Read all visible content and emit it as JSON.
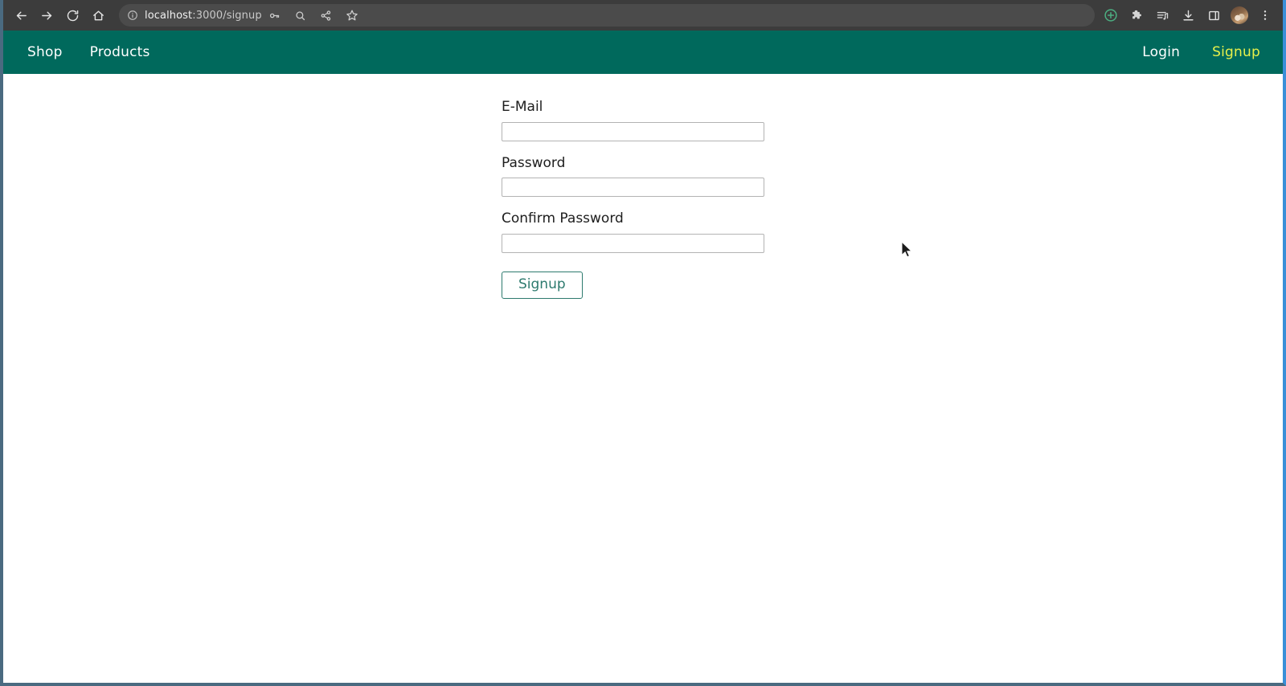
{
  "browser": {
    "url_host": "localhost",
    "url_path": ":3000/signup",
    "back_icon": "back-arrow-icon",
    "forward_icon": "forward-arrow-icon",
    "reload_icon": "reload-icon",
    "home_icon": "home-icon",
    "site_info_icon": "site-info-icon",
    "password_manager_icon": "key-icon",
    "zoom_icon": "magnifier-icon",
    "share_icon": "share-icon",
    "bookmark_icon": "star-icon",
    "add_icon": "green-plus-circle-icon",
    "extensions_icon": "puzzle-piece-icon",
    "reading_list_icon": "playlist-icon",
    "downloads_icon": "download-icon",
    "side_panel_icon": "side-panel-icon",
    "profile_label": "avatar",
    "menu_icon": "three-dot-menu-icon"
  },
  "site_nav": {
    "left_links": [
      {
        "label": "Shop",
        "active": false
      },
      {
        "label": "Products",
        "active": false
      }
    ],
    "right_links": [
      {
        "label": "Login",
        "active": false
      },
      {
        "label": "Signup",
        "active": true
      }
    ]
  },
  "form": {
    "fields": [
      {
        "label": "E-Mail",
        "value": "",
        "placeholder": "",
        "type": "email"
      },
      {
        "label": "Password",
        "value": "",
        "placeholder": "",
        "type": "password"
      },
      {
        "label": "Confirm Password",
        "value": "",
        "placeholder": "",
        "type": "password"
      }
    ],
    "submit_label": "Signup"
  },
  "colors": {
    "nav_background": "#00695c",
    "nav_link": "#ffffff",
    "nav_link_active": "#e8f04a",
    "button_accent": "#2d7a6e",
    "toolbar_background": "#3c3c3c",
    "omnibox_background": "#4b4b4b",
    "page_background": "#ffffff",
    "window_focus_border": "#3a8fd8"
  }
}
